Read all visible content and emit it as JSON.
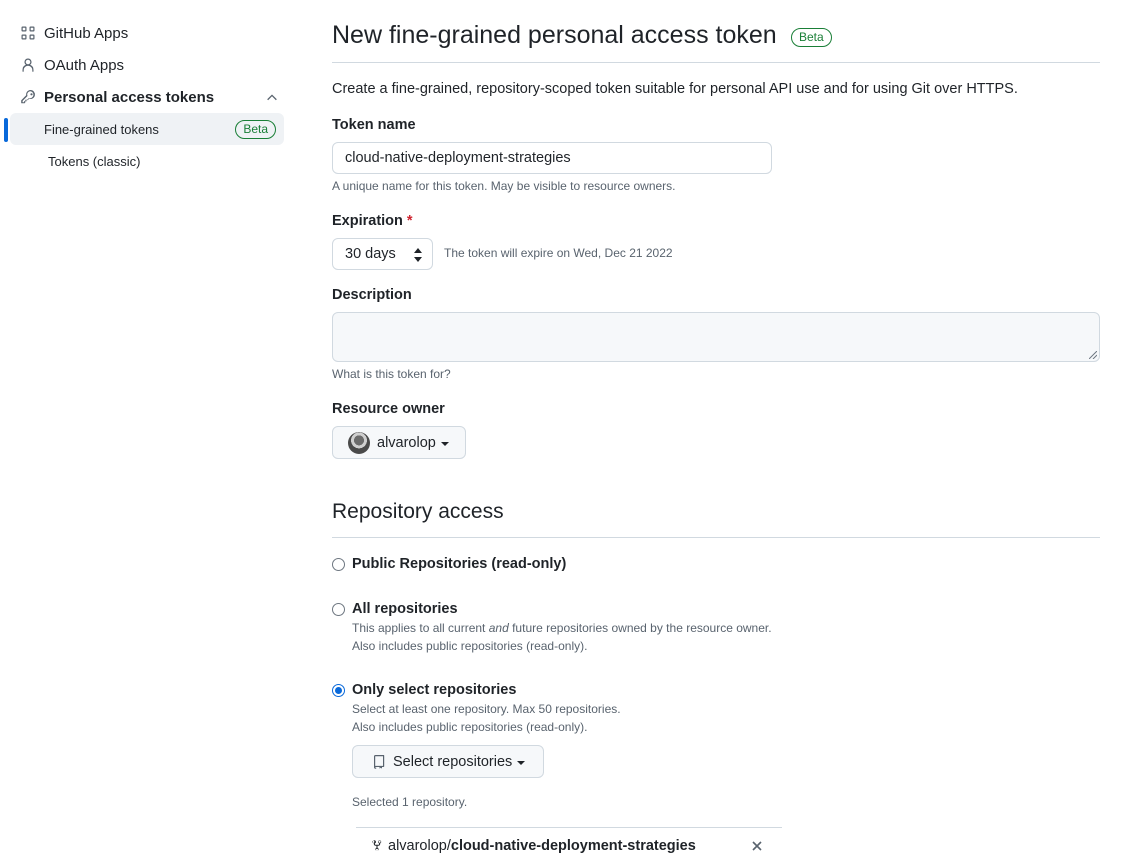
{
  "sidebar": {
    "items": [
      {
        "label": "GitHub Apps",
        "icon": "apps-grid-icon"
      },
      {
        "label": "OAuth Apps",
        "icon": "person-icon"
      },
      {
        "label": "Personal access tokens",
        "icon": "key-icon",
        "expanded": true
      }
    ],
    "subitems": [
      {
        "label": "Fine-grained tokens",
        "badge": "Beta",
        "active": true
      },
      {
        "label": "Tokens (classic)"
      }
    ]
  },
  "header": {
    "title": "New fine-grained personal access token",
    "badge": "Beta",
    "lead": "Create a fine-grained, repository-scoped token suitable for personal API use and for using Git over HTTPS."
  },
  "form": {
    "token_name": {
      "label": "Token name",
      "value": "cloud-native-deployment-strategies",
      "note": "A unique name for this token. May be visible to resource owners."
    },
    "expiration": {
      "label": "Expiration",
      "required_mark": "*",
      "selected": "30 days",
      "note": "The token will expire on Wed, Dec 21 2022"
    },
    "description": {
      "label": "Description",
      "value": "",
      "note": "What is this token for?"
    },
    "resource_owner": {
      "label": "Resource owner",
      "selected": "alvarolop"
    }
  },
  "repository_access": {
    "title": "Repository access",
    "options": [
      {
        "label": "Public Repositories (read-only)",
        "checked": false,
        "desc": []
      },
      {
        "label": "All repositories",
        "checked": false,
        "desc": [
          "This applies to all current ",
          "and",
          " future repositories owned by the resource owner.",
          "Also includes public repositories (read-only)."
        ]
      },
      {
        "label": "Only select repositories",
        "checked": true,
        "desc": [
          "Select at least one repository. Max 50 repositories.",
          "Also includes public repositories (read-only)."
        ]
      }
    ],
    "select_button": "Select repositories",
    "selected_count": "Selected 1 repository.",
    "selected_repos": [
      {
        "owner": "alvarolop/",
        "name": "cloud-native-deployment-strategies"
      }
    ]
  },
  "colors": {
    "accent": "#0969da",
    "beta_green": "#1a7f37",
    "required_red": "#cf222e"
  }
}
